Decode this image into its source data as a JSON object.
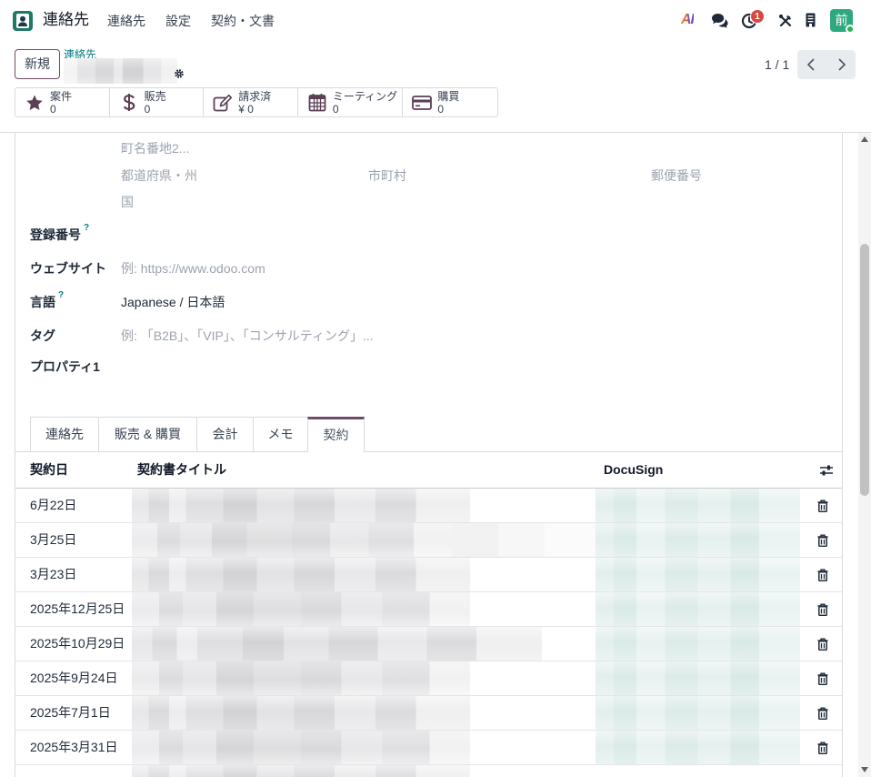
{
  "navbar": {
    "app_name": "連絡先",
    "menu": [
      {
        "label": "連絡先"
      },
      {
        "label": "設定"
      },
      {
        "label": "契約・文書"
      }
    ],
    "ai_label": "AI",
    "activity_count": "1",
    "avatar_initial": "前"
  },
  "control_panel": {
    "new_button": "新規",
    "breadcrumb": "連絡先",
    "pager": "1 / 1"
  },
  "smart_buttons": [
    {
      "icon": "star-icon",
      "label": "案件",
      "value": "0"
    },
    {
      "icon": "dollar-icon",
      "label": "販売",
      "value": "0"
    },
    {
      "icon": "invoice-edit-icon",
      "label": "請求済",
      "value": "¥ 0"
    },
    {
      "icon": "calendar-icon",
      "label": "ミーティング",
      "value": "0"
    },
    {
      "icon": "credit-card-icon",
      "label": "購買",
      "value": "0"
    }
  ],
  "address": {
    "street2_placeholder": "町名番地2...",
    "state_placeholder": "都道府県・州",
    "city_placeholder": "市町村",
    "zip_placeholder": "郵便番号",
    "country_placeholder": "国"
  },
  "fields": {
    "vat_label": "登録番号",
    "help_mark": "?",
    "website_label": "ウェブサイト",
    "website_placeholder": "例: https://www.odoo.com",
    "lang_label": "言語",
    "lang_value": "Japanese / 日本語",
    "tags_label": "タグ",
    "tags_placeholder": "例: 「B2B」、「VIP」、「コンサルティング」...",
    "properties_label": "プロパティ1"
  },
  "tabs": [
    {
      "label": "連絡先"
    },
    {
      "label": "販売 & 購買"
    },
    {
      "label": "会計"
    },
    {
      "label": "メモ"
    },
    {
      "label": "契約",
      "active": true
    }
  ],
  "contracts": {
    "columns": [
      "契約日",
      "契約書タイトル",
      "DocuSign"
    ],
    "rows": [
      {
        "date": "6月22日"
      },
      {
        "date": "3月25日"
      },
      {
        "date": "3月23日"
      },
      {
        "date": "2025年12月25日"
      },
      {
        "date": "2025年10月29日"
      },
      {
        "date": "2025年9月24日"
      },
      {
        "date": "2025年7月1日"
      },
      {
        "date": "2025年3月31日"
      }
    ]
  },
  "colors": {
    "primary": "#714B67",
    "link": "#017E84",
    "badge": "#D9473F",
    "avatar": "#2EA87E"
  }
}
